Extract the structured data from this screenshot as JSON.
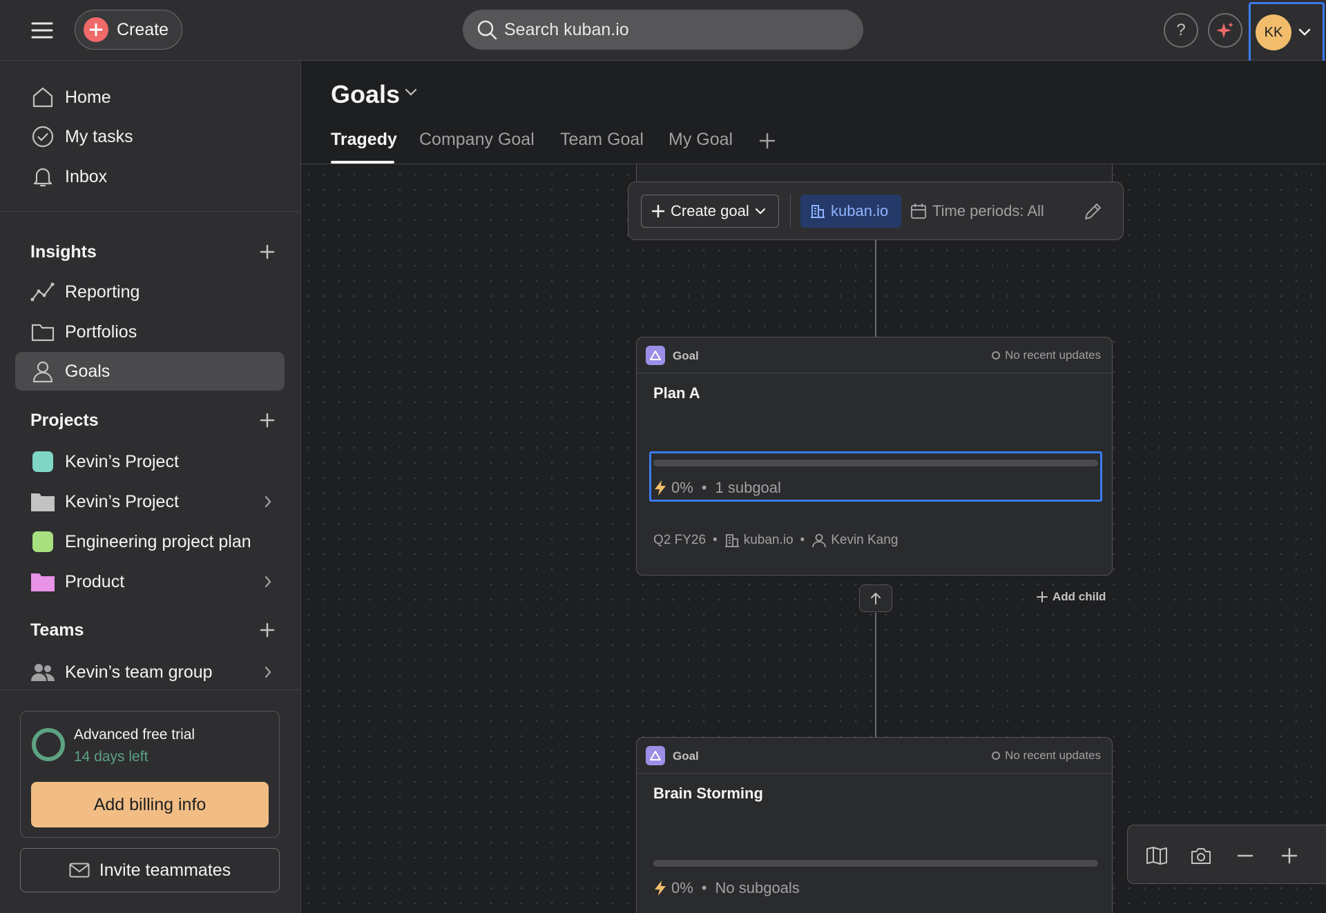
{
  "topbar": {
    "create_label": "Create",
    "search_placeholder": "Search kuban.io",
    "help_label": "?",
    "avatar_initials": "KK"
  },
  "sidebar": {
    "nav": [
      {
        "label": "Home",
        "icon": "home-icon"
      },
      {
        "label": "My tasks",
        "icon": "check-circle-icon"
      },
      {
        "label": "Inbox",
        "icon": "bell-icon"
      }
    ],
    "insights": {
      "title": "Insights",
      "items": [
        {
          "label": "Reporting",
          "icon": "line-chart-icon"
        },
        {
          "label": "Portfolios",
          "icon": "folder-icon"
        },
        {
          "label": "Goals",
          "icon": "person-icon",
          "active": true
        }
      ]
    },
    "projects": {
      "title": "Projects",
      "items": [
        {
          "label": "Kevin’s Project",
          "color": "#7fd6c5",
          "kind": "swatch"
        },
        {
          "label": "Kevin’s Project",
          "color": "#c3c3c4",
          "kind": "folder",
          "expandable": true
        },
        {
          "label": "Engineering project plan",
          "color": "#a8e07f",
          "kind": "swatch"
        },
        {
          "label": "Product",
          "color": "#e892e8",
          "kind": "folder",
          "expandable": true
        }
      ]
    },
    "teams": {
      "title": "Teams",
      "items": [
        {
          "label": "Kevin’s team group",
          "icon": "team-icon",
          "expandable": true
        }
      ]
    },
    "trial": {
      "title": "Advanced free trial",
      "days_left": "14 days left",
      "billing_label": "Add billing info"
    },
    "invite_label": "Invite teammates"
  },
  "main": {
    "title": "Goals",
    "tabs": [
      "Tragedy",
      "Company Goal",
      "Team Goal",
      "My Goal"
    ],
    "active_tab": "Tragedy",
    "toolbar": {
      "create_goal_label": "Create goal",
      "org_label": "kuban.io",
      "time_periods_label": "Time periods: All"
    },
    "goals": [
      {
        "type": "Goal",
        "status": "No recent updates",
        "name": "Plan A",
        "progress": 0,
        "percent_label": "0%",
        "subgoals_label": "1 subgoal",
        "period": "Q2 FY26",
        "org": "kuban.io",
        "owner": "Kevin Kang"
      },
      {
        "type": "Goal",
        "status": "No recent updates",
        "name": "Brain Storming",
        "progress": 0,
        "percent_label": "0%",
        "subgoals_label": "No subgoals"
      }
    ],
    "add_child_label": "Add child",
    "separator": "•"
  },
  "colors": {
    "accent_blue": "#3a7bf0",
    "create_red": "#f06a6a",
    "avatar_yellow": "#f1bd6c",
    "trial_green": "#5da283",
    "billing_orange": "#f1bd84",
    "goal_purple": "#9b8fe8"
  }
}
